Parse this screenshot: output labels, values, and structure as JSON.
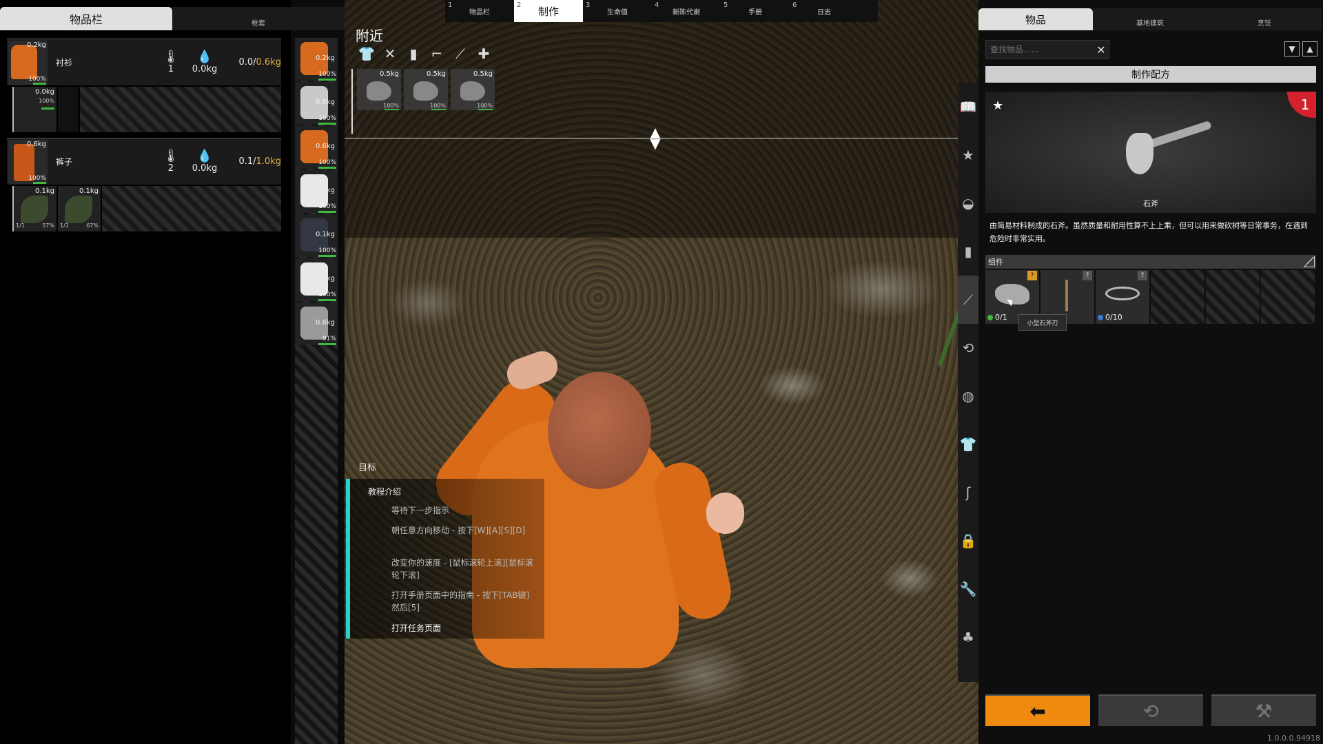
{
  "colors": {
    "accent": "#f08a0e",
    "health_bar": "#3fb93f",
    "objective_bar": "#2fd0c8",
    "badge": "#d3222e",
    "weight_max": "#e0b040"
  },
  "left_tabs": {
    "main": "物品栏",
    "sub": "枪套"
  },
  "clothing": [
    {
      "name": "衬衫",
      "thumb_weight": "0.2kg",
      "thumb_pct": "100%",
      "temp_value": "1",
      "water_value": "0.0kg",
      "cap_current": "0.0/",
      "cap_max": "0.6kg",
      "slots": [
        {
          "w": "0.0kg",
          "p": "100%"
        }
      ]
    },
    {
      "name": "裤子",
      "thumb_weight": "0.6kg",
      "thumb_pct": "100%",
      "temp_value": "2",
      "water_value": "0.0kg",
      "cap_current": "0.1/",
      "cap_max": "1.0kg",
      "slots": [
        {
          "w": "0.1kg",
          "p": "57%",
          "q": "1/1"
        },
        {
          "w": "0.1kg",
          "p": "67%",
          "q": "1/1"
        }
      ]
    }
  ],
  "equipment": [
    {
      "w": "0.2kg",
      "p": "100%",
      "color": "#d86a20"
    },
    {
      "w": "0.6kg",
      "p": "100%",
      "color": "#c9c9c9"
    },
    {
      "w": "0.6kg",
      "p": "100%",
      "color": "#d86a20"
    },
    {
      "w": "0.2kg",
      "p": "100%",
      "color": "#e8e8e8"
    },
    {
      "w": "0.1kg",
      "p": "100%",
      "color": "#333844"
    },
    {
      "w": "0.2kg",
      "p": "100%",
      "color": "#e8e8e8"
    },
    {
      "w": "0.6kg",
      "p": "91%",
      "color": "#9a9a9a"
    }
  ],
  "nearby": {
    "title": "附近",
    "items": [
      {
        "w": "0.5kg",
        "p": "100%"
      },
      {
        "w": "0.5kg",
        "p": "100%"
      },
      {
        "w": "0.5kg",
        "p": "100%"
      }
    ]
  },
  "top_tabs": [
    {
      "n": "1",
      "label": "物品栏"
    },
    {
      "n": "2",
      "label": "制作"
    },
    {
      "n": "3",
      "label": "生命值"
    },
    {
      "n": "4",
      "label": "新陈代谢"
    },
    {
      "n": "5",
      "label": "手册"
    },
    {
      "n": "6",
      "label": "日志"
    }
  ],
  "objectives": {
    "title": "目标",
    "heading": "教程介绍",
    "items": [
      "等待下一步指示",
      "朝任意方向移动 - 按下[W][A][S][D]",
      "改变你的速度 - [鼠标滚轮上滚][鼠标滚轮下滚]",
      "打开手册页面中的指南 - 按下[TAB键]然后[5]",
      "打开任务页面"
    ]
  },
  "right_tabs": [
    "物品",
    "基地建筑",
    "烹饪"
  ],
  "search": {
    "placeholder": "查找物品......"
  },
  "recipe": {
    "header": "制作配方",
    "badge": "1",
    "item_name": "石斧",
    "description": "由简易材料制成的石斧。虽然质量和耐用性算不上上乘，但可以用来做砍树等日常事务，在遇到危险时非常实用。",
    "components_label": "组件",
    "components": [
      {
        "count": "0/1",
        "dot": "#3fb93f"
      },
      {
        "count": ""
      },
      {
        "count": "0/10",
        "dot": "#3a7ad9"
      }
    ],
    "tooltip": "小型石斧刃"
  },
  "version": "1.0.0.0.94918"
}
